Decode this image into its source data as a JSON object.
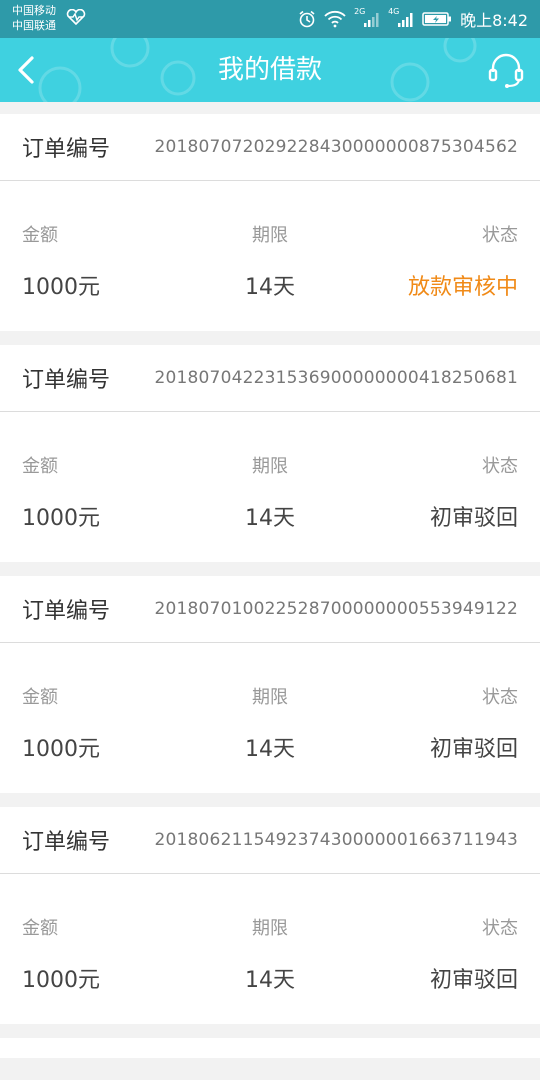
{
  "status_bar": {
    "carrier1": "中国移动",
    "carrier2": "中国联通",
    "time": "晚上8:42",
    "net1": "2G",
    "net2": "4G"
  },
  "header": {
    "title": "我的借款",
    "accent": "#3fd1e0"
  },
  "labels": {
    "order": "订单编号",
    "amount": "金额",
    "term": "期限",
    "status": "状态"
  },
  "orders": [
    {
      "order_no": "201807072029228430000000875304562",
      "amount": "1000元",
      "term": "14天",
      "status": "放款审核中",
      "status_color": "#f08a17"
    },
    {
      "order_no": "201807042231536900000000418250681",
      "amount": "1000元",
      "term": "14天",
      "status": "初审驳回",
      "status_color": "#444444"
    },
    {
      "order_no": "201807010022528700000000553949122",
      "amount": "1000元",
      "term": "14天",
      "status": "初审驳回",
      "status_color": "#444444"
    },
    {
      "order_no": "201806211549237430000001663711943",
      "amount": "1000元",
      "term": "14天",
      "status": "初审驳回",
      "status_color": "#444444"
    }
  ]
}
